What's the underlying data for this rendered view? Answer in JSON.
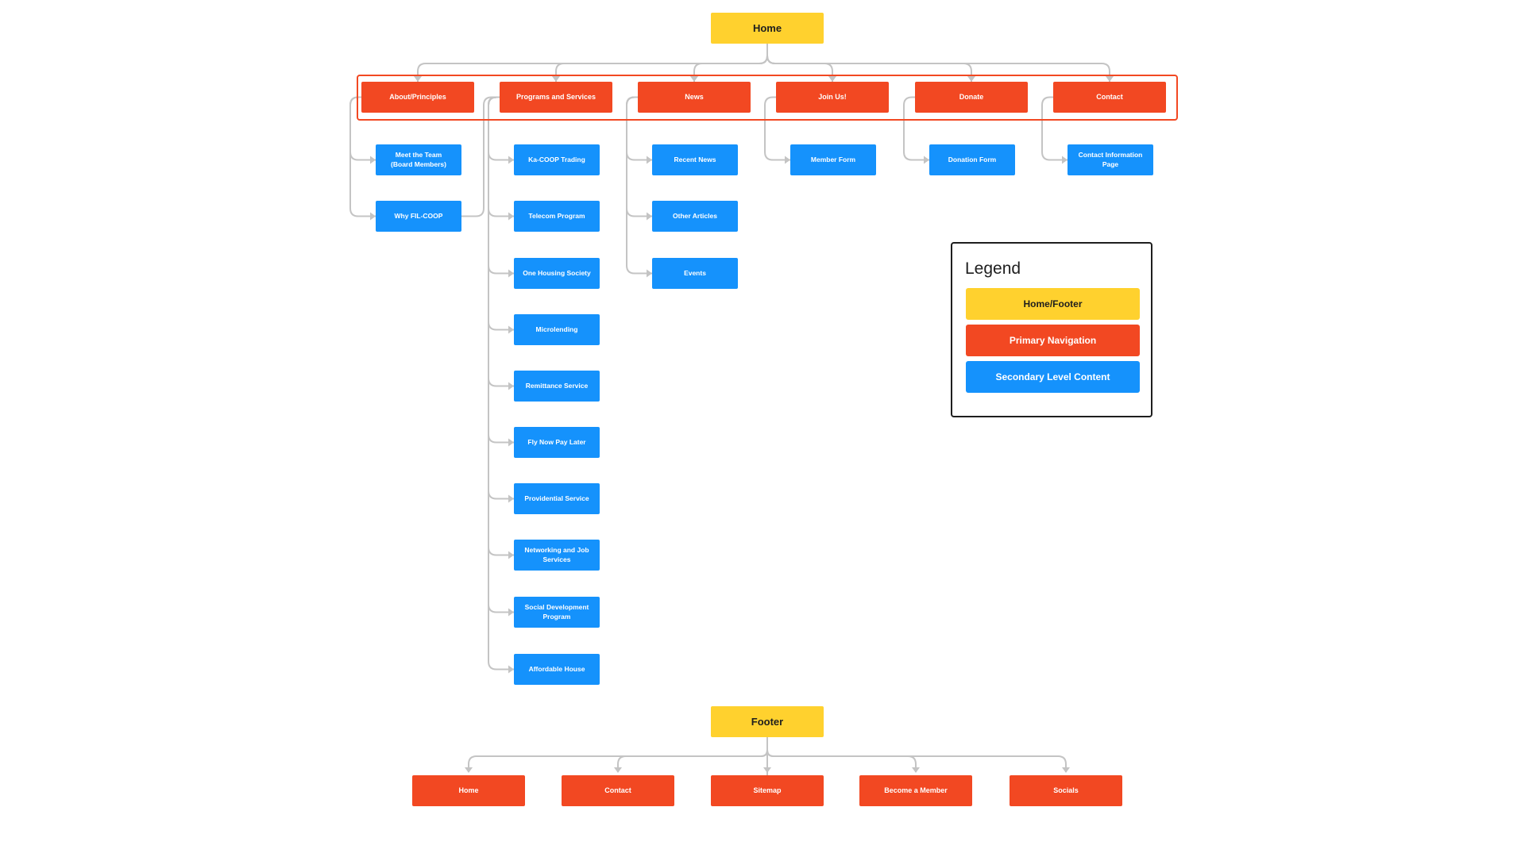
{
  "home": {
    "label": "Home"
  },
  "primary_nav": [
    {
      "label": "About/Principles",
      "children": [
        "Meet the Team (Board Members)",
        "Why FIL-COOP"
      ]
    },
    {
      "label": "Programs and Services",
      "children": [
        "Ka-COOP Trading",
        "Telecom Program",
        "One Housing Society",
        "Microlending",
        "Remittance Service",
        "Fly Now Pay Later",
        "Providential Service",
        "Networking and Job Services",
        "Social Development Program",
        "Affordable House"
      ]
    },
    {
      "label": "News",
      "children": [
        "Recent News",
        "Other Articles",
        "Events"
      ]
    },
    {
      "label": "Join Us!",
      "children": [
        "Member Form"
      ]
    },
    {
      "label": "Donate",
      "children": [
        "Donation Form"
      ]
    },
    {
      "label": "Contact",
      "children": [
        "Contact Information Page"
      ]
    }
  ],
  "footer": {
    "label": "Footer",
    "children": [
      "Home",
      "Contact",
      "Sitemap",
      "Become a Member",
      "Socials"
    ]
  },
  "legend": {
    "title": "Legend",
    "items": [
      {
        "label": "Home/Footer",
        "color": "#FFD12E"
      },
      {
        "label": "Primary Navigation",
        "color": "#F24822"
      },
      {
        "label": "Secondary Level Content",
        "color": "#1592FC"
      }
    ]
  },
  "colors": {
    "yellow": "#FFD12E",
    "red": "#F24822",
    "blue": "#1592FC",
    "connector": "#c4c4c4"
  }
}
